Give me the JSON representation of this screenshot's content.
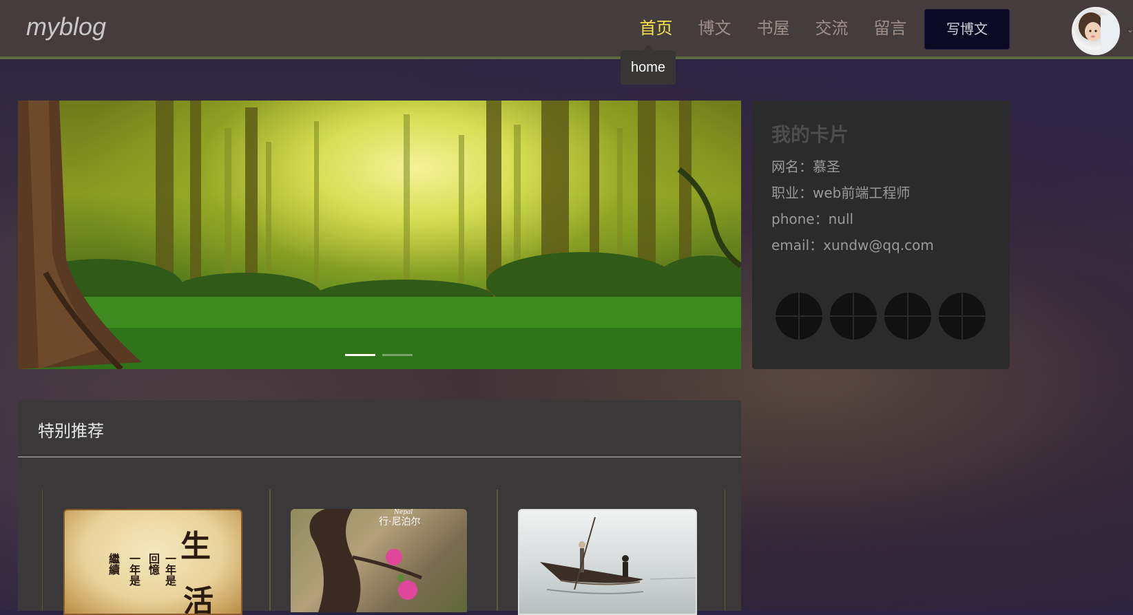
{
  "header": {
    "logo": "myblog",
    "nav": [
      {
        "label": "首页",
        "active": true
      },
      {
        "label": "博文",
        "active": false
      },
      {
        "label": "书屋",
        "active": false
      },
      {
        "label": "交流",
        "active": false
      },
      {
        "label": "留言",
        "active": false
      }
    ],
    "tooltip": "home",
    "write_button": "写博文"
  },
  "card": {
    "title": "我的卡片",
    "lines": [
      "网名：慕圣",
      "职业：web前端工程师",
      "phone：null",
      "email：xundw@qq.com"
    ]
  },
  "recommend": {
    "title": "特别推荐",
    "thumb1_text": [
      "生",
      "活",
      "一年是",
      "回憶",
      "一年是",
      "繼續"
    ],
    "thumb2_text": [
      "行·尼泊尔",
      "Nepal"
    ]
  },
  "colors": {
    "accent": "#f3e24a",
    "header_bg": "#453d3d",
    "button_bg": "#0b0924"
  }
}
